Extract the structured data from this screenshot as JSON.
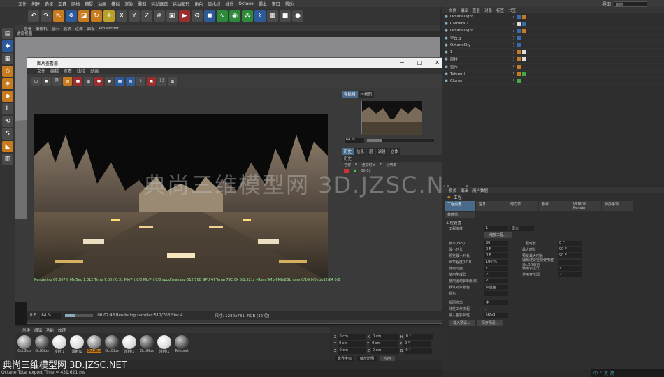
{
  "menubar": [
    "文件",
    "创建",
    "选择",
    "工具",
    "网格",
    "捕捉",
    "动画",
    "模拟",
    "渲染",
    "雕刻",
    "运动跟踪",
    "运动图形",
    "角色",
    "流水线",
    "插件",
    "Octane",
    "脚本",
    "窗口",
    "帮助"
  ],
  "interface_label": "界面",
  "interface_value": "启动",
  "viewport": {
    "menu": [
      "查看",
      "摄像机",
      "显示",
      "选项",
      "过滤",
      "面板",
      "ProRender"
    ],
    "title": "透视视图"
  },
  "picture_viewer": {
    "title": "图片查看器",
    "menu": [
      "文件",
      "编辑",
      "查看",
      "比较",
      "动画"
    ],
    "nav_tabs": [
      "导航器",
      "柱状图"
    ],
    "zoom": "64 %",
    "zoom_fraction": 0.22,
    "history_tabs": [
      "历史",
      "信息",
      "层",
      "滤镜",
      "立体"
    ],
    "history_label": "历史",
    "history_header": [
      "名称",
      "R",
      "渲染时间",
      "F",
      "分辨率"
    ],
    "history_row": [
      "00:02"
    ],
    "bottom_zoom": "64 %",
    "bottom_progress": 0.35,
    "bottom_status": "00:07:48 Rendering samples:512/768 Stat:4",
    "bottom_size": "尺寸: 1280x731, RGB (32 位)",
    "render_status": "Rendering 66.667%  Ms/Sec 1.012  Time 7:08 / 0:31  Mk/Prt 0/0  Mk/Prt 0/0  sppd/maxspp 512/768  GPU[4]  Temp 79C  Ek 8/1.521s  vRam 9Mb/6Mb/8Gb  gmv 0/1G  0/0  rgb32/64 0/0"
  },
  "watermark": "典尚三维模型网 3D.JZSC.NET",
  "object_manager": {
    "menu": [
      "文件",
      "编辑",
      "查看",
      "对象",
      "标签",
      "书签"
    ],
    "rows": [
      "OctaneLight",
      "Camera.1",
      "OctaneLight",
      "空白.1",
      "OctaneSky",
      "1",
      "同柱",
      "空白",
      "Teleport",
      "Cloner"
    ]
  },
  "attributes": {
    "menu": [
      "模式",
      "编辑",
      "用户数据"
    ],
    "head": "工程",
    "tabs": [
      "工程设置",
      "信息",
      "动力学",
      "参考",
      "Octane Render",
      "待办事项",
      "帧插值"
    ],
    "section": "工程设置",
    "scale_label": "工程缩放",
    "scale_value": "1",
    "scale_unit": "厘米",
    "scale_button": "缩放工程...",
    "fields_left": [
      {
        "label": "帧率(FPS)",
        "value": "30"
      },
      {
        "label": "最小时长",
        "value": "0 F"
      },
      {
        "label": "预览最小时长",
        "value": "0 F"
      },
      {
        "label": "细节程度(LOD)",
        "value": "100 %"
      },
      {
        "label": "使用动画",
        "value": "✓"
      },
      {
        "label": "使用生成器",
        "value": "✓"
      },
      {
        "label": "使用运动剪辑系统",
        "value": "✓"
      },
      {
        "label": "默认对象颜色",
        "value": "灰蓝色"
      },
      {
        "label": "颜色",
        "value": ""
      }
    ],
    "fields_right": [
      {
        "label": "工程时长",
        "value": "0 F"
      },
      {
        "label": "最大时长",
        "value": "90 F"
      },
      {
        "label": "预览最大时长",
        "value": "90 F"
      },
      {
        "label": "编辑渲染检视使用渲染LOD级别",
        "value": ""
      },
      {
        "label": "使用表达式",
        "value": "✓"
      },
      {
        "label": "使用变形器",
        "value": "✓"
      }
    ],
    "viewclip_label": "视图修剪",
    "viewclip_value": "中",
    "linear_label": "线性工作流程",
    "linear_value": "✓",
    "input_label": "输入色彩特性",
    "input_value": "sRGB",
    "btn_load": "载入预设...",
    "btn_save": "保存预设..."
  },
  "material_manager": {
    "menu": [
      "创建",
      "编辑",
      "功能",
      "纹理"
    ],
    "items": [
      "OctGlos",
      "OctGlos",
      "漫射/1",
      "漫射/1",
      "OctGlos",
      "OctGlos",
      "漫射/1",
      "OctGlos",
      "漫射/1",
      "Teleport"
    ],
    "selected": 4
  },
  "coordinates": {
    "rows": [
      [
        "X",
        "0 cm",
        "X",
        "0 cm",
        "H",
        "0 °"
      ],
      [
        "Y",
        "0 cm",
        "Y",
        "0 cm",
        "P",
        "0 °"
      ],
      [
        "Z",
        "0 cm",
        "Z",
        "0 cm",
        "B",
        "0 °"
      ]
    ],
    "mode1": "世界坐标",
    "mode2": "缩放比例",
    "apply": "应用"
  },
  "bottom_watermark": "典尚三维模型网 3D.JZSC.NET",
  "status": "Octane:Total export Time = 431.621 ms",
  "taskbar": [
    "中",
    "°",
    "英",
    "简"
  ],
  "colors": {
    "accent": "#4a6a8a",
    "highlight": "#c87a1e"
  }
}
